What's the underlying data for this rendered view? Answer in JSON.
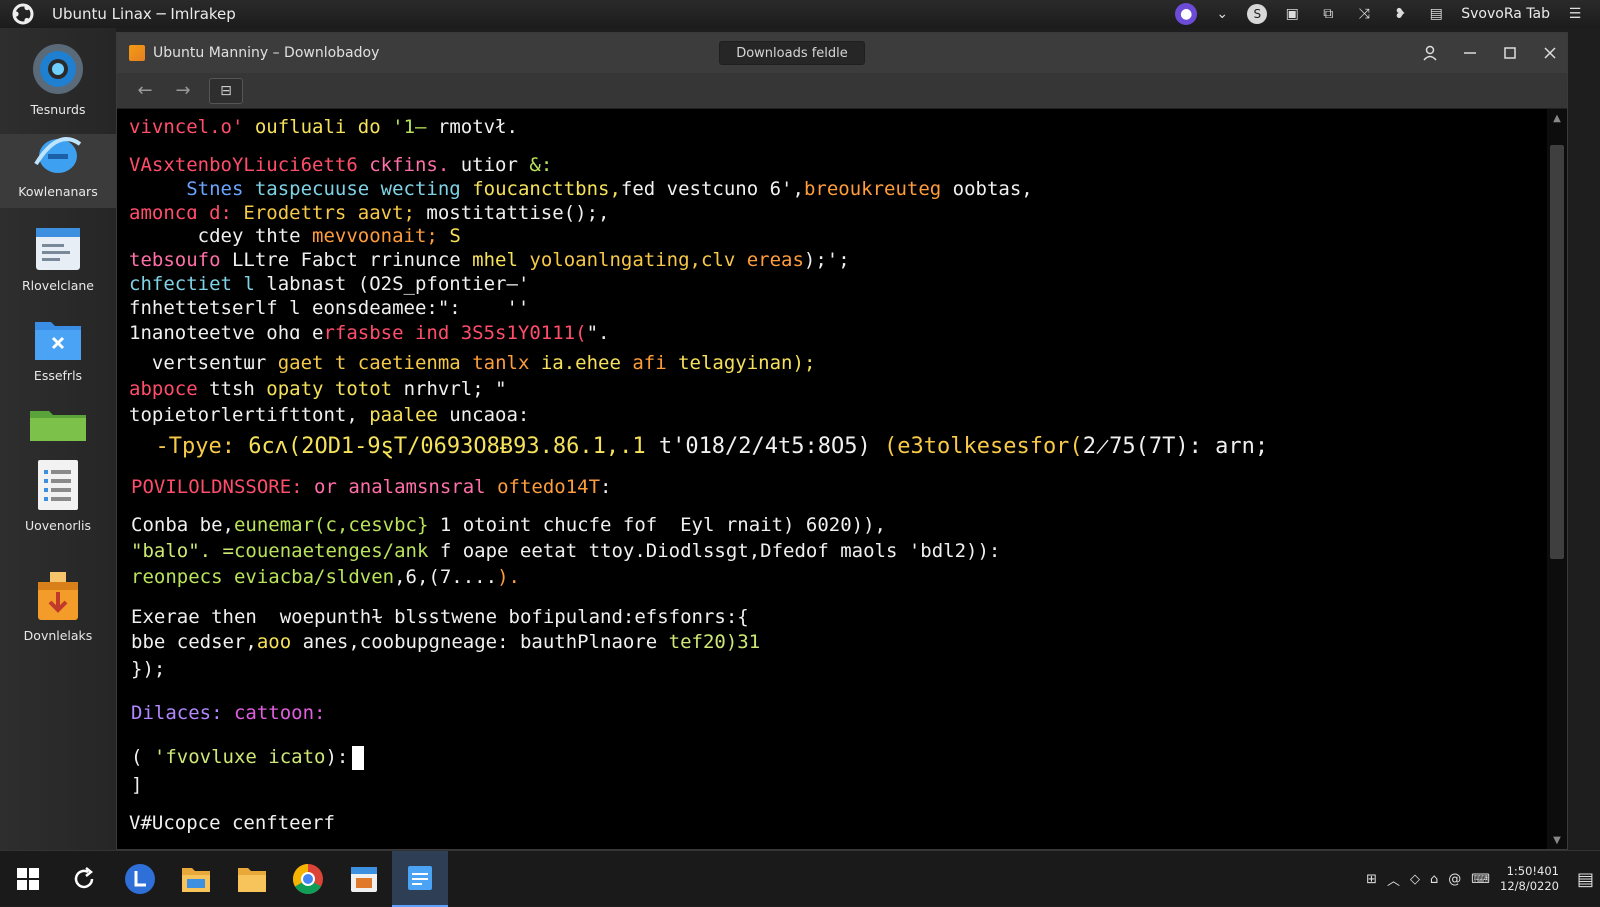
{
  "topbar": {
    "title": "Ubuntu Linax ─ Imlrakep",
    "tray_label": "SvovoRa Tab",
    "icons": [
      "ubuntu-logo-icon",
      "purple-app-icon",
      "chevron-down-icon",
      "skype-icon",
      "window-switch-icon",
      "clipboard-icon",
      "share-icon",
      "chat-icon",
      "screen-icon",
      "menu-icon"
    ]
  },
  "dock": {
    "items": [
      {
        "label": "Tesnurds",
        "icon": "globe-icon"
      },
      {
        "label": "Kowlenanars",
        "icon": "browser-e-icon"
      },
      {
        "label": "Rlovelclane",
        "icon": "document-window-icon"
      },
      {
        "label": "Essefrls",
        "icon": "folder-x-icon"
      },
      {
        "label": "",
        "icon": "green-folder-icon"
      },
      {
        "label": "Uovenorlis",
        "icon": "spreadsheet-icon"
      },
      {
        "label": "Dovnlelaks",
        "icon": "download-box-icon"
      }
    ]
  },
  "window": {
    "title": "Ubuntu Manniny –  Downlobadoy",
    "pill": "Downloads feldle",
    "controls": [
      "user-icon",
      "minimize-icon",
      "maximize-icon",
      "close-icon"
    ]
  },
  "terminal": {
    "lines": [
      {
        "segs": [
          [
            "vivncel.o' ",
            "red"
          ],
          [
            "oufluali do ",
            "yellow"
          ],
          [
            "'1– ",
            "green"
          ],
          [
            "rmotvł.",
            "white"
          ]
        ]
      },
      {
        "segs": [
          [
            "VAsxtenboYLiuci6ett6 ",
            "red"
          ],
          [
            "ckfins. ",
            "pink"
          ],
          [
            "utior ",
            "white"
          ],
          [
            "&:",
            "green"
          ]
        ]
      },
      {
        "segs": [
          [
            "     Stnes ",
            "blue"
          ],
          [
            "taspecuuse wecting ",
            "cyan"
          ],
          [
            "foucancttbns,",
            "yellow"
          ],
          [
            "fed vestcuno 6',",
            "white"
          ],
          [
            "breoukreuteg ",
            "orange"
          ],
          [
            "oobtas,",
            "white"
          ]
        ]
      },
      {
        "segs": [
          [
            "amoncɑ d: ",
            "red"
          ],
          [
            "Erodettrs aavt; ",
            "gold"
          ],
          [
            "mostitattise();,",
            "white"
          ]
        ]
      },
      {
        "segs": [
          [
            "      cdey thte ",
            "white"
          ],
          [
            "mevvoonait; ",
            "orange"
          ],
          [
            "S",
            "yellow"
          ]
        ]
      },
      {
        "segs": [
          [
            "tebsoufo ",
            "pink"
          ],
          [
            "LLtre Fabct rrinunce ",
            "white"
          ],
          [
            "mhel ",
            "yellow"
          ],
          [
            "yoloanlngating,clv ",
            "gold"
          ],
          [
            "ereas",
            "orange"
          ],
          [
            ");';",
            "white"
          ]
        ]
      },
      {
        "segs": [
          [
            "chfectiet l ",
            "cyan"
          ],
          [
            "labnast (O2S_pfontier–'",
            "white"
          ]
        ]
      },
      {
        "segs": [
          [
            "fnhettetserlf l eonsdeamee:\": ",
            "white"
          ],
          [
            "   ''",
            "white"
          ]
        ]
      },
      {
        "segs": [
          [
            "1nanoteetve ohɑ e",
            "white"
          ],
          [
            "rfasbse ind 3S5s1Y0111(",
            "red"
          ],
          [
            "\".",
            "white"
          ]
        ]
      },
      {
        "segs": [
          [
            "  vertsentɯr ",
            "white"
          ],
          [
            "gaet t caetienma ",
            "gold"
          ],
          [
            "tanlx ",
            "orange"
          ],
          [
            "ia.ehee ",
            "yellow"
          ],
          [
            "afi ",
            "orange"
          ],
          [
            "telagyinan);",
            "yellow"
          ]
        ]
      },
      {
        "segs": [
          [
            "abpoce ",
            "red"
          ],
          [
            "ttsh ",
            "white"
          ],
          [
            "opaty totot ",
            "yellow"
          ],
          [
            "nrhvrl; \"",
            "white"
          ]
        ]
      },
      {
        "segs": [
          [
            "topietorlertifttont, ",
            "white"
          ],
          [
            "paalee ",
            "yellow"
          ],
          [
            "uncaoa:",
            "white"
          ]
        ]
      },
      {
        "segs": [
          [
            "  -Tpye: ",
            "gold"
          ],
          [
            "6cʌ(2OD1-9ȿT/0693O8Ƀ93.86.1,.1 ",
            "yellow"
          ],
          [
            "t'018/2/4t5:8O5) ",
            "white"
          ],
          [
            "(e3tolkesesfor(",
            "gold"
          ],
          [
            "2̷75(7T): arn;",
            "white"
          ]
        ]
      },
      {
        "segs": [
          [
            "POVILOLDNSSORE: ",
            "red"
          ],
          [
            "or analamsnsral ",
            "pink"
          ],
          [
            "oftedo14T",
            "orange"
          ],
          [
            ":",
            "white"
          ]
        ]
      },
      {
        "segs": [
          [
            "Conba be,",
            "white"
          ],
          [
            "eunemar(c,cesvbc} ",
            "green"
          ],
          [
            "1 otoint chucfe fof  Eyl rnait) 6020)),",
            "white"
          ]
        ]
      },
      {
        "segs": [
          [
            "\"balo\". =",
            "lime"
          ],
          [
            "couenaetenges/ank ",
            "green"
          ],
          [
            "f oape eetat ttoy.Diodlssgt,Dfedof maols 'bdl2)):",
            "white"
          ]
        ]
      },
      {
        "segs": [
          [
            "reonpecs ",
            "green"
          ],
          [
            "eviacba/sldven",
            "green"
          ],
          [
            ",6,(7....",
            "white"
          ],
          [
            ").",
            "orange"
          ]
        ]
      },
      {
        "segs": [
          [
            "Exerae then  woepunthɫ blsstwene ",
            "white"
          ],
          [
            "bofipuland:efsfonrs:{",
            "white"
          ]
        ]
      },
      {
        "segs": [
          [
            "bbe cedser,",
            "white"
          ],
          [
            "aoo ",
            "yellow"
          ],
          [
            "anes,coobupgneage: bauthPlnaore ",
            "white"
          ],
          [
            "tef20)31",
            "lime"
          ]
        ]
      },
      {
        "segs": [
          [
            "});",
            "white"
          ]
        ]
      },
      {
        "segs": [
          [
            "Dilaces: ",
            "purple"
          ],
          [
            "cattoon:",
            "magenta"
          ]
        ]
      },
      {
        "segs": [
          [
            "( ",
            "white"
          ],
          [
            "'fvovluxe icato",
            "lime"
          ],
          [
            "):",
            "white"
          ]
        ],
        "cursor": true
      },
      {
        "segs": [
          [
            "]",
            "white"
          ]
        ]
      },
      {
        "segs": [
          [
            "V#Ucopce cenfteerf",
            "white"
          ]
        ]
      }
    ]
  },
  "taskbar": {
    "icons": [
      "windows-start-icon",
      "refresh-icon",
      "blue-l-app-icon",
      "file-manager-icon",
      "folder-icon",
      "chrome-icon",
      "calendar-app-icon",
      "notes-app-icon"
    ],
    "tray_icons": [
      "network-icon",
      "chevron-up-icon",
      "diamond-icon",
      "home-icon",
      "at-icon",
      "keyboard-icon"
    ],
    "time": "1:50!401",
    "date": "12/8/0220",
    "notification_icon": "notification-icon"
  },
  "colors": {
    "terminal_bg": "#000000",
    "titlebar": "#3c3c3c",
    "dock": "#2b2b2b",
    "accent": "#5fa0ff"
  }
}
